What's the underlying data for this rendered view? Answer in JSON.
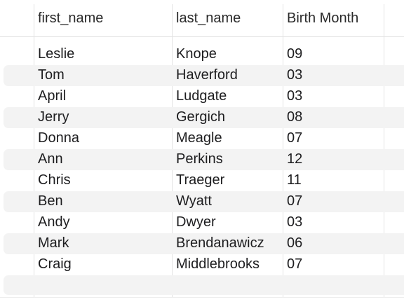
{
  "table": {
    "columns": [
      "first_name",
      "last_name",
      "Birth Month"
    ],
    "rows": [
      [
        "Leslie",
        "Knope",
        "09"
      ],
      [
        "Tom",
        "Haverford",
        "03"
      ],
      [
        "April",
        "Ludgate",
        "03"
      ],
      [
        "Jerry",
        "Gergich",
        "08"
      ],
      [
        "Donna",
        "Meagle",
        "07"
      ],
      [
        "Ann",
        "Perkins",
        "12"
      ],
      [
        "Chris",
        "Traeger",
        "11"
      ],
      [
        "Ben",
        "Wyatt",
        "07"
      ],
      [
        "Andy",
        "Dwyer",
        "03"
      ],
      [
        "Mark",
        "Brendanawicz",
        "06"
      ],
      [
        "Craig",
        "Middlebrooks",
        "07"
      ]
    ]
  }
}
